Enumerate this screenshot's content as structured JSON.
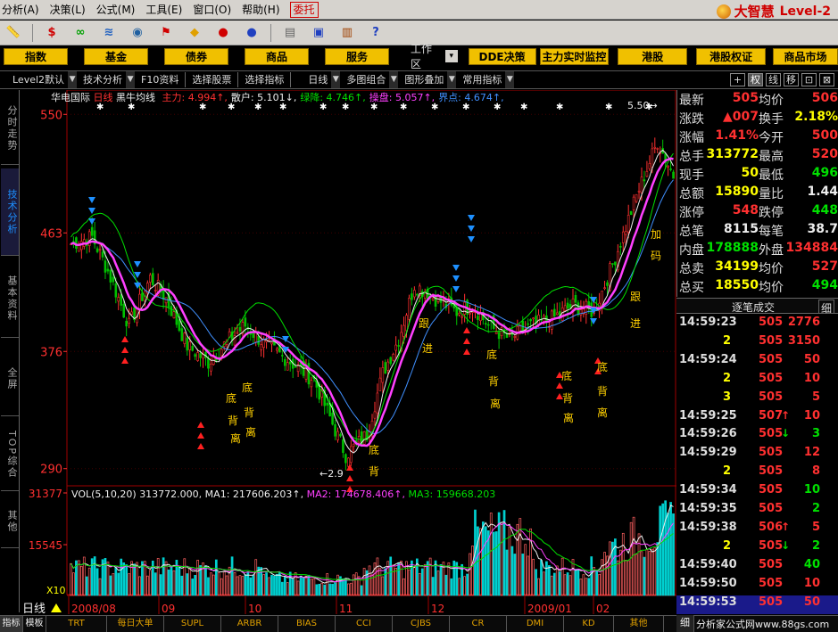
{
  "menu": {
    "items": [
      "分析(A)",
      "决策(L)",
      "公式(M)",
      "工具(E)",
      "窗口(O)",
      "帮助(H)"
    ],
    "delegate_label": "委托",
    "logo_text": "大智慧",
    "logo_level": "Level-2"
  },
  "nav": {
    "buttons": [
      "指数",
      "基金",
      "债券",
      "商品",
      "服务"
    ],
    "workspace_label": "工作区",
    "right_buttons": [
      "DDE决策",
      "主力实时监控",
      "港股",
      "港股权证",
      "商品市场"
    ]
  },
  "tabs": {
    "items": [
      "Level2默认",
      "技术分析",
      "F10资料",
      "选择股票",
      "选择指标",
      "日线",
      "多图组合",
      "图形叠加",
      "常用指标"
    ],
    "right_boxes": [
      "+",
      "权",
      "线",
      "移",
      "⊡",
      "⊠"
    ]
  },
  "side_tabs": [
    "分时走势",
    "技术分析",
    "基本资料",
    "全屏",
    "TOP综合",
    "其他"
  ],
  "chart": {
    "stock_name": "华电国际",
    "period": "日线",
    "indicator": "黑牛均线",
    "legend": [
      {
        "label": "主力",
        "value": "4.994",
        "arrow": "↑",
        "color": "#ff3030"
      },
      {
        "label": "散户",
        "value": "5.101",
        "arrow": "↓",
        "color": "#eeeeee"
      },
      {
        "label": "绿降",
        "value": "4.746",
        "arrow": "↑",
        "color": "#00e000"
      },
      {
        "label": "操盘",
        "value": "5.057",
        "arrow": "↑",
        "color": "#ff40ff"
      },
      {
        "label": "界点",
        "value": "4.674",
        "arrow": "↑",
        "color": "#4090ff"
      }
    ],
    "y_labels": [
      "550",
      "463",
      "376",
      "290"
    ],
    "high_label": "5.50",
    "low_label": "2.9",
    "annotations": [
      {
        "text": "底",
        "color": "#ffd000"
      },
      {
        "text": "背",
        "color": "#ffd000"
      },
      {
        "text": "离",
        "color": "#ffd000"
      },
      {
        "text": "跟",
        "color": "#ffd000"
      },
      {
        "text": "进",
        "color": "#ffd000"
      },
      {
        "text": "加",
        "color": "#ffd000"
      },
      {
        "text": "码",
        "color": "#ffd000"
      }
    ],
    "volume": {
      "legend_title": "VOL(5,10,20)",
      "total": "313772.000",
      "ma1_label": "MA1",
      "ma1_value": "217606.203",
      "ma2_label": "MA2",
      "ma2_value": "174678.406",
      "ma3_label": "MA3",
      "ma3_value": "159668.203",
      "y_labels": [
        "31377",
        "15545"
      ],
      "unit_label": "X10"
    },
    "x_labels": [
      "2008/08",
      "09",
      "10",
      "11",
      "12",
      "2009/01",
      "02"
    ],
    "mode_label": "日线"
  },
  "bottom_tabs": [
    "指标",
    "模板",
    "TRT",
    "每日大单",
    "SUPL",
    "ARBR",
    "BIAS",
    "CCI",
    "CJBS",
    "CR",
    "DMI",
    "KD",
    "其他"
  ],
  "quote": {
    "rows": [
      {
        "l1": "最新",
        "v1": "505",
        "c1": "#ff3030",
        "l2": "均价",
        "v2": "506",
        "c2": "#ff3030"
      },
      {
        "l1": "涨跌",
        "v1": "▲007",
        "c1": "#ff3030",
        "l2": "换手",
        "v2": "2.18%",
        "c2": "#ffff00"
      },
      {
        "l1": "涨幅",
        "v1": "1.41%",
        "c1": "#ff3030",
        "l2": "今开",
        "v2": "500",
        "c2": "#ff3030"
      },
      {
        "l1": "总手",
        "v1": "313772",
        "c1": "#ffff00",
        "l2": "最高",
        "v2": "520",
        "c2": "#ff3030"
      },
      {
        "l1": "现手",
        "v1": "50",
        "c1": "#ffff00",
        "l2": "最低",
        "v2": "496",
        "c2": "#00e000"
      },
      {
        "l1": "总额",
        "v1": "15890",
        "c1": "#ffff00",
        "l2": "量比",
        "v2": "1.44",
        "c2": "#eeeeee"
      },
      {
        "l1": "涨停",
        "v1": "548",
        "c1": "#ff3030",
        "l2": "跌停",
        "v2": "448",
        "c2": "#00e000"
      },
      {
        "l1": "总笔",
        "v1": "8115",
        "c1": "#eeeeee",
        "l2": "每笔",
        "v2": "38.7",
        "c2": "#eeeeee"
      },
      {
        "l1": "内盘",
        "v1": "178888",
        "c1": "#00e000",
        "l2": "外盘",
        "v2": "134884",
        "c2": "#ff3030"
      },
      {
        "l1": "总卖",
        "v1": "34199",
        "c1": "#ffff00",
        "l2": "均价",
        "v2": "527",
        "c2": "#ff3030"
      },
      {
        "l1": "总买",
        "v1": "18550",
        "c1": "#ffff00",
        "l2": "均价",
        "v2": "494",
        "c2": "#00e000"
      }
    ]
  },
  "trades": {
    "header": "逐笔成交",
    "detail": "细",
    "rows": [
      {
        "time": "14:59:23",
        "price": "505",
        "dir": "",
        "vol": "2776",
        "vcolor": "#ff3030"
      },
      {
        "time": "",
        "price": "505",
        "dir": "",
        "vol": "3150",
        "vcolor": "#ff3030",
        "prefix": "2"
      },
      {
        "time": "14:59:24",
        "price": "505",
        "dir": "",
        "vol": "50",
        "vcolor": "#ff3030"
      },
      {
        "time": "",
        "price": "505",
        "dir": "",
        "vol": "10",
        "vcolor": "#ff3030",
        "prefix": "2"
      },
      {
        "time": "",
        "price": "505",
        "dir": "",
        "vol": "5",
        "vcolor": "#ff3030",
        "prefix": "3"
      },
      {
        "time": "14:59:25",
        "price": "507",
        "dir": "↑",
        "vol": "10",
        "vcolor": "#ff3030"
      },
      {
        "time": "14:59:26",
        "price": "505",
        "dir": "↓",
        "vol": "3",
        "vcolor": "#00e000"
      },
      {
        "time": "14:59:29",
        "price": "505",
        "dir": "",
        "vol": "12",
        "vcolor": "#ff3030"
      },
      {
        "time": "",
        "price": "505",
        "dir": "",
        "vol": "8",
        "vcolor": "#ff3030",
        "prefix": "2"
      },
      {
        "time": "14:59:34",
        "price": "505",
        "dir": "",
        "vol": "10",
        "vcolor": "#00e000"
      },
      {
        "time": "14:59:35",
        "price": "505",
        "dir": "",
        "vol": "2",
        "vcolor": "#00e000"
      },
      {
        "time": "14:59:38",
        "price": "506",
        "dir": "↑",
        "vol": "5",
        "vcolor": "#ff3030"
      },
      {
        "time": "",
        "price": "505",
        "dir": "↓",
        "vol": "2",
        "vcolor": "#00e000",
        "prefix": "2"
      },
      {
        "time": "14:59:40",
        "price": "505",
        "dir": "",
        "vol": "40",
        "vcolor": "#00e000"
      },
      {
        "time": "14:59:50",
        "price": "505",
        "dir": "",
        "vol": "10",
        "vcolor": "#ff3030"
      },
      {
        "time": "14:59:53",
        "price": "505",
        "dir": "",
        "vol": "50",
        "vcolor": "#ff3030"
      }
    ],
    "footer": "细"
  },
  "watermark": "分析家公式网www.88gs.com"
}
